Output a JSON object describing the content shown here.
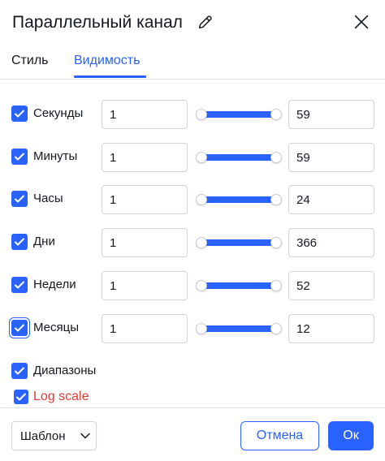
{
  "dialog": {
    "title": "Параллельный канал",
    "icons": {
      "edit": "pencil-icon",
      "close": "close-icon"
    }
  },
  "tabs": [
    {
      "label": "Стиль",
      "active": false
    },
    {
      "label": "Видимость",
      "active": true
    }
  ],
  "rows": [
    {
      "label": "Секунды",
      "checked": true,
      "from": "1",
      "to": "59"
    },
    {
      "label": "Минуты",
      "checked": true,
      "from": "1",
      "to": "59"
    },
    {
      "label": "Часы",
      "checked": true,
      "from": "1",
      "to": "24"
    },
    {
      "label": "Дни",
      "checked": true,
      "from": "1",
      "to": "366"
    },
    {
      "label": "Недели",
      "checked": true,
      "from": "1",
      "to": "52"
    },
    {
      "label": "Месяцы",
      "checked": true,
      "from": "1",
      "to": "12"
    }
  ],
  "extras": {
    "ranges": {
      "label": "Диапазоны",
      "checked": true
    },
    "log_scale": {
      "label": "Log scale",
      "checked": true,
      "color": "#e53935"
    }
  },
  "footer": {
    "template_label": "Шаблон",
    "cancel_label": "Отмена",
    "ok_label": "Ок"
  },
  "colors": {
    "accent": "#2962ff",
    "text": "#131722",
    "border": "#d1d4dc",
    "divider": "#e0e3eb"
  }
}
